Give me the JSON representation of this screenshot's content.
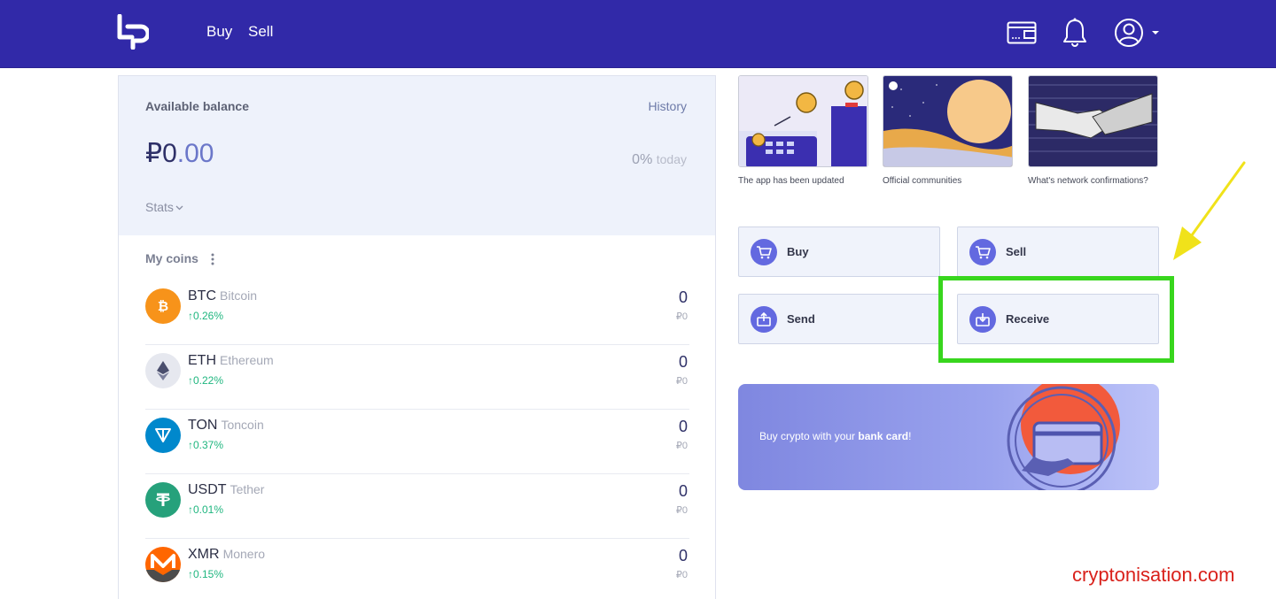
{
  "header": {
    "nav": {
      "buy": "Buy",
      "sell": "Sell"
    },
    "icons": [
      "wallet-icon",
      "bell-icon",
      "user-icon",
      "caret-down-icon"
    ],
    "bg_color": "#3129a8"
  },
  "balance": {
    "label": "Available balance",
    "history": "History",
    "amount_int": "₽0",
    "amount_dec": ".00",
    "change_pct": "0%",
    "change_period": "today",
    "stats": "Stats"
  },
  "coins": {
    "title": "My coins",
    "items": [
      {
        "ticker": "BTC",
        "name": "Bitcoin",
        "change": "↑0.26%",
        "amount": "0",
        "fiat": "₽0",
        "color": "#f7931a"
      },
      {
        "ticker": "ETH",
        "name": "Ethereum",
        "change": "↑0.22%",
        "amount": "0",
        "fiat": "₽0",
        "color": "#e6e8ef"
      },
      {
        "ticker": "TON",
        "name": "Toncoin",
        "change": "↑0.37%",
        "amount": "0",
        "fiat": "₽0",
        "color": "#0088cc"
      },
      {
        "ticker": "USDT",
        "name": "Tether",
        "change": "↑0.01%",
        "amount": "0",
        "fiat": "₽0",
        "color": "#26a17b"
      },
      {
        "ticker": "XMR",
        "name": "Monero",
        "change": "↑0.15%",
        "amount": "0",
        "fiat": "₽0",
        "color": "#ff6600"
      }
    ]
  },
  "news": [
    {
      "caption": "The app has been updated"
    },
    {
      "caption": "Official communities"
    },
    {
      "caption": "What's network confirmations?"
    }
  ],
  "actions": {
    "buy": "Buy",
    "sell": "Sell",
    "send": "Send",
    "receive": "Receive"
  },
  "promo": {
    "text_before": "Buy crypto with your ",
    "text_bold": "bank card",
    "text_after": "!"
  },
  "watermark": "cryptonisation.com",
  "colors": {
    "accent": "#6369e0",
    "positive": "#1fb67f",
    "highlight": "#38d61d",
    "arrow": "#f0e21a"
  }
}
